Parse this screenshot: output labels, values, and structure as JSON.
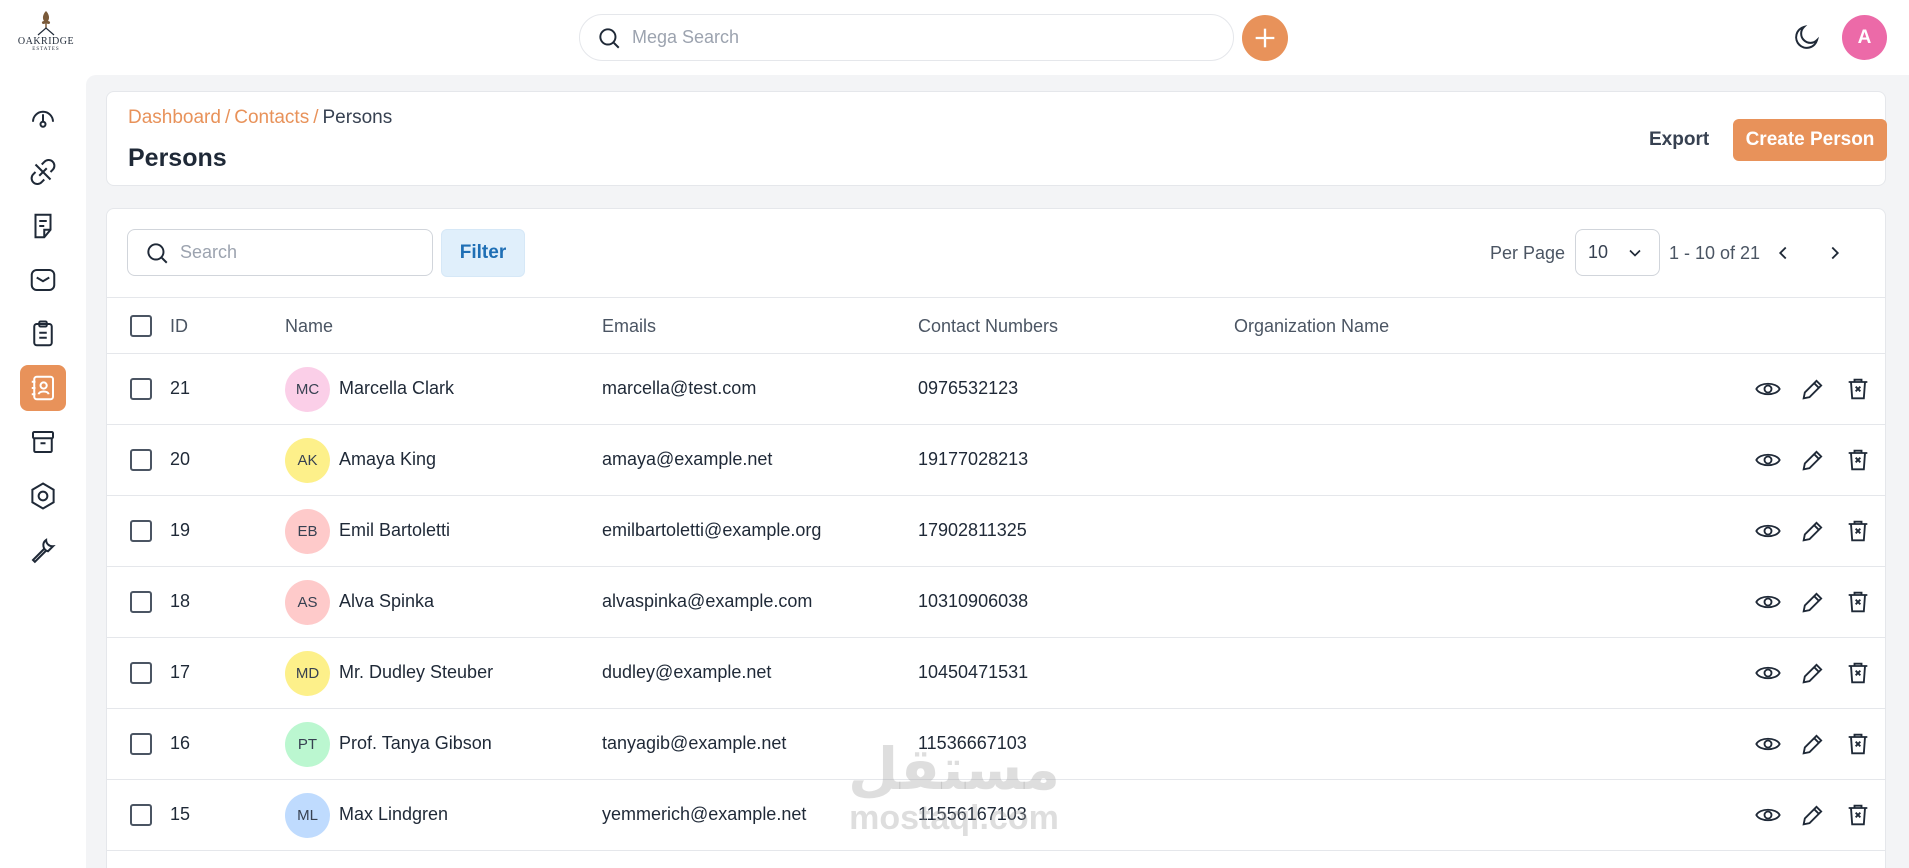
{
  "brand": {
    "logo_text": "OAKRIDGE",
    "logo_sub": "ESTATES"
  },
  "topbar": {
    "search_placeholder": "Mega Search",
    "user_initial": "A"
  },
  "sidebar": {
    "items": [
      {
        "name": "dashboard",
        "icon": "gauge-icon",
        "active": false
      },
      {
        "name": "leads",
        "icon": "link-icon",
        "active": false
      },
      {
        "name": "quotes",
        "icon": "document-icon",
        "active": false
      },
      {
        "name": "mail",
        "icon": "mail-icon",
        "active": false
      },
      {
        "name": "activities",
        "icon": "clipboard-icon",
        "active": false
      },
      {
        "name": "contacts",
        "icon": "contact-card-icon",
        "active": true
      },
      {
        "name": "products",
        "icon": "archive-icon",
        "active": false
      },
      {
        "name": "settings",
        "icon": "settings-icon",
        "active": false
      },
      {
        "name": "configuration",
        "icon": "wrench-icon",
        "active": false
      }
    ]
  },
  "header": {
    "breadcrumb": {
      "dashboard": "Dashboard",
      "contacts": "Contacts",
      "current": "Persons",
      "separator": "/"
    },
    "title": "Persons",
    "export_label": "Export",
    "create_label": "Create Person"
  },
  "toolbar": {
    "search_placeholder": "Search",
    "filter_label": "Filter",
    "per_page_label": "Per Page",
    "per_page_value": "10",
    "range_text": "1 - 10 of 21"
  },
  "table": {
    "columns": {
      "id": "ID",
      "name": "Name",
      "emails": "Emails",
      "contact_numbers": "Contact Numbers",
      "organization": "Organization Name"
    },
    "rows": [
      {
        "id": "21",
        "initials": "MC",
        "name": "Marcella Clark",
        "email": "marcella@test.com",
        "phone": "0976532123",
        "organization": "",
        "avatar_color": "#fbcfe8"
      },
      {
        "id": "20",
        "initials": "AK",
        "name": "Amaya King",
        "email": "amaya@example.net",
        "phone": "19177028213",
        "organization": "",
        "avatar_color": "#fdf08a"
      },
      {
        "id": "19",
        "initials": "EB",
        "name": "Emil Bartoletti",
        "email": "emilbartoletti@example.org",
        "phone": "17902811325",
        "organization": "",
        "avatar_color": "#fecaca"
      },
      {
        "id": "18",
        "initials": "AS",
        "name": "Alva Spinka",
        "email": "alvaspinka@example.com",
        "phone": "10310906038",
        "organization": "",
        "avatar_color": "#fecaca"
      },
      {
        "id": "17",
        "initials": "MD",
        "name": "Mr. Dudley Steuber",
        "email": "dudley@example.net",
        "phone": "10450471531",
        "organization": "",
        "avatar_color": "#fdf08a"
      },
      {
        "id": "16",
        "initials": "PT",
        "name": "Prof. Tanya Gibson",
        "email": "tanyagib@example.net",
        "phone": "11536667103",
        "organization": "",
        "avatar_color": "#bbf7d0"
      },
      {
        "id": "15",
        "initials": "ML",
        "name": "Max Lindgren",
        "email": "yemmerich@example.net",
        "phone": "11556167103",
        "organization": "",
        "avatar_color": "#bfdbfe"
      }
    ]
  },
  "watermark": {
    "arabic": "مستقل",
    "latin": "mostaql.com"
  },
  "colors": {
    "accent": "#e8925a",
    "filter_bg": "#e0effb",
    "filter_text": "#1f6fb5",
    "user_avatar": "#ec6aa8"
  }
}
